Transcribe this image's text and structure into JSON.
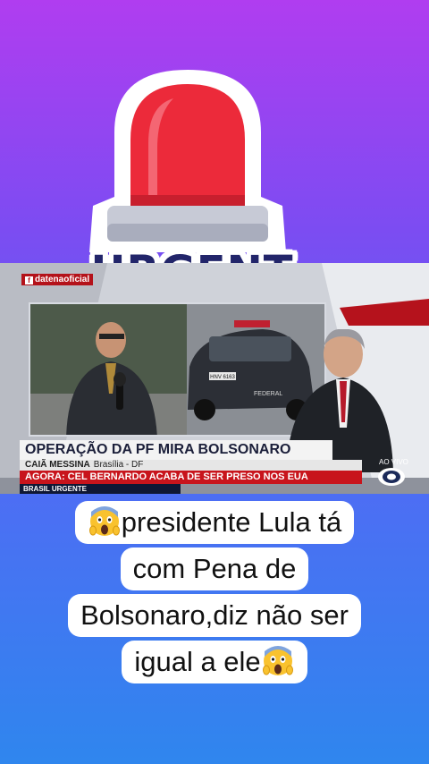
{
  "sticker": {
    "label": "URGENT",
    "colors": {
      "dome": "#ec2a3a",
      "base": "#c7cad6",
      "text": "#22256a"
    }
  },
  "news": {
    "channel_tag": "datenaoficial",
    "headline": "OPERAÇÃO DA PF MIRA BOLSONARO",
    "reporter_name": "CAIÃ MESSINA",
    "reporter_location": "Brasília - DF",
    "ticker": "AGORA: CEL BERNARDO ACABA DE SER PRESO NOS EUA",
    "program": "BRASIL URGENTE",
    "live_label": "AO VIVO",
    "car_plate": "HNV 6163",
    "car_door_text": "FEDERAL",
    "colors": {
      "ticker_red": "#c8141c",
      "program_bar": "#0f1735"
    }
  },
  "caption": {
    "emoji": "scream-emoji",
    "line1": "presidente Lula tá",
    "line2": "com Pena de",
    "line3": "Bolsonaro,diz não ser",
    "line4": "igual a ele"
  }
}
